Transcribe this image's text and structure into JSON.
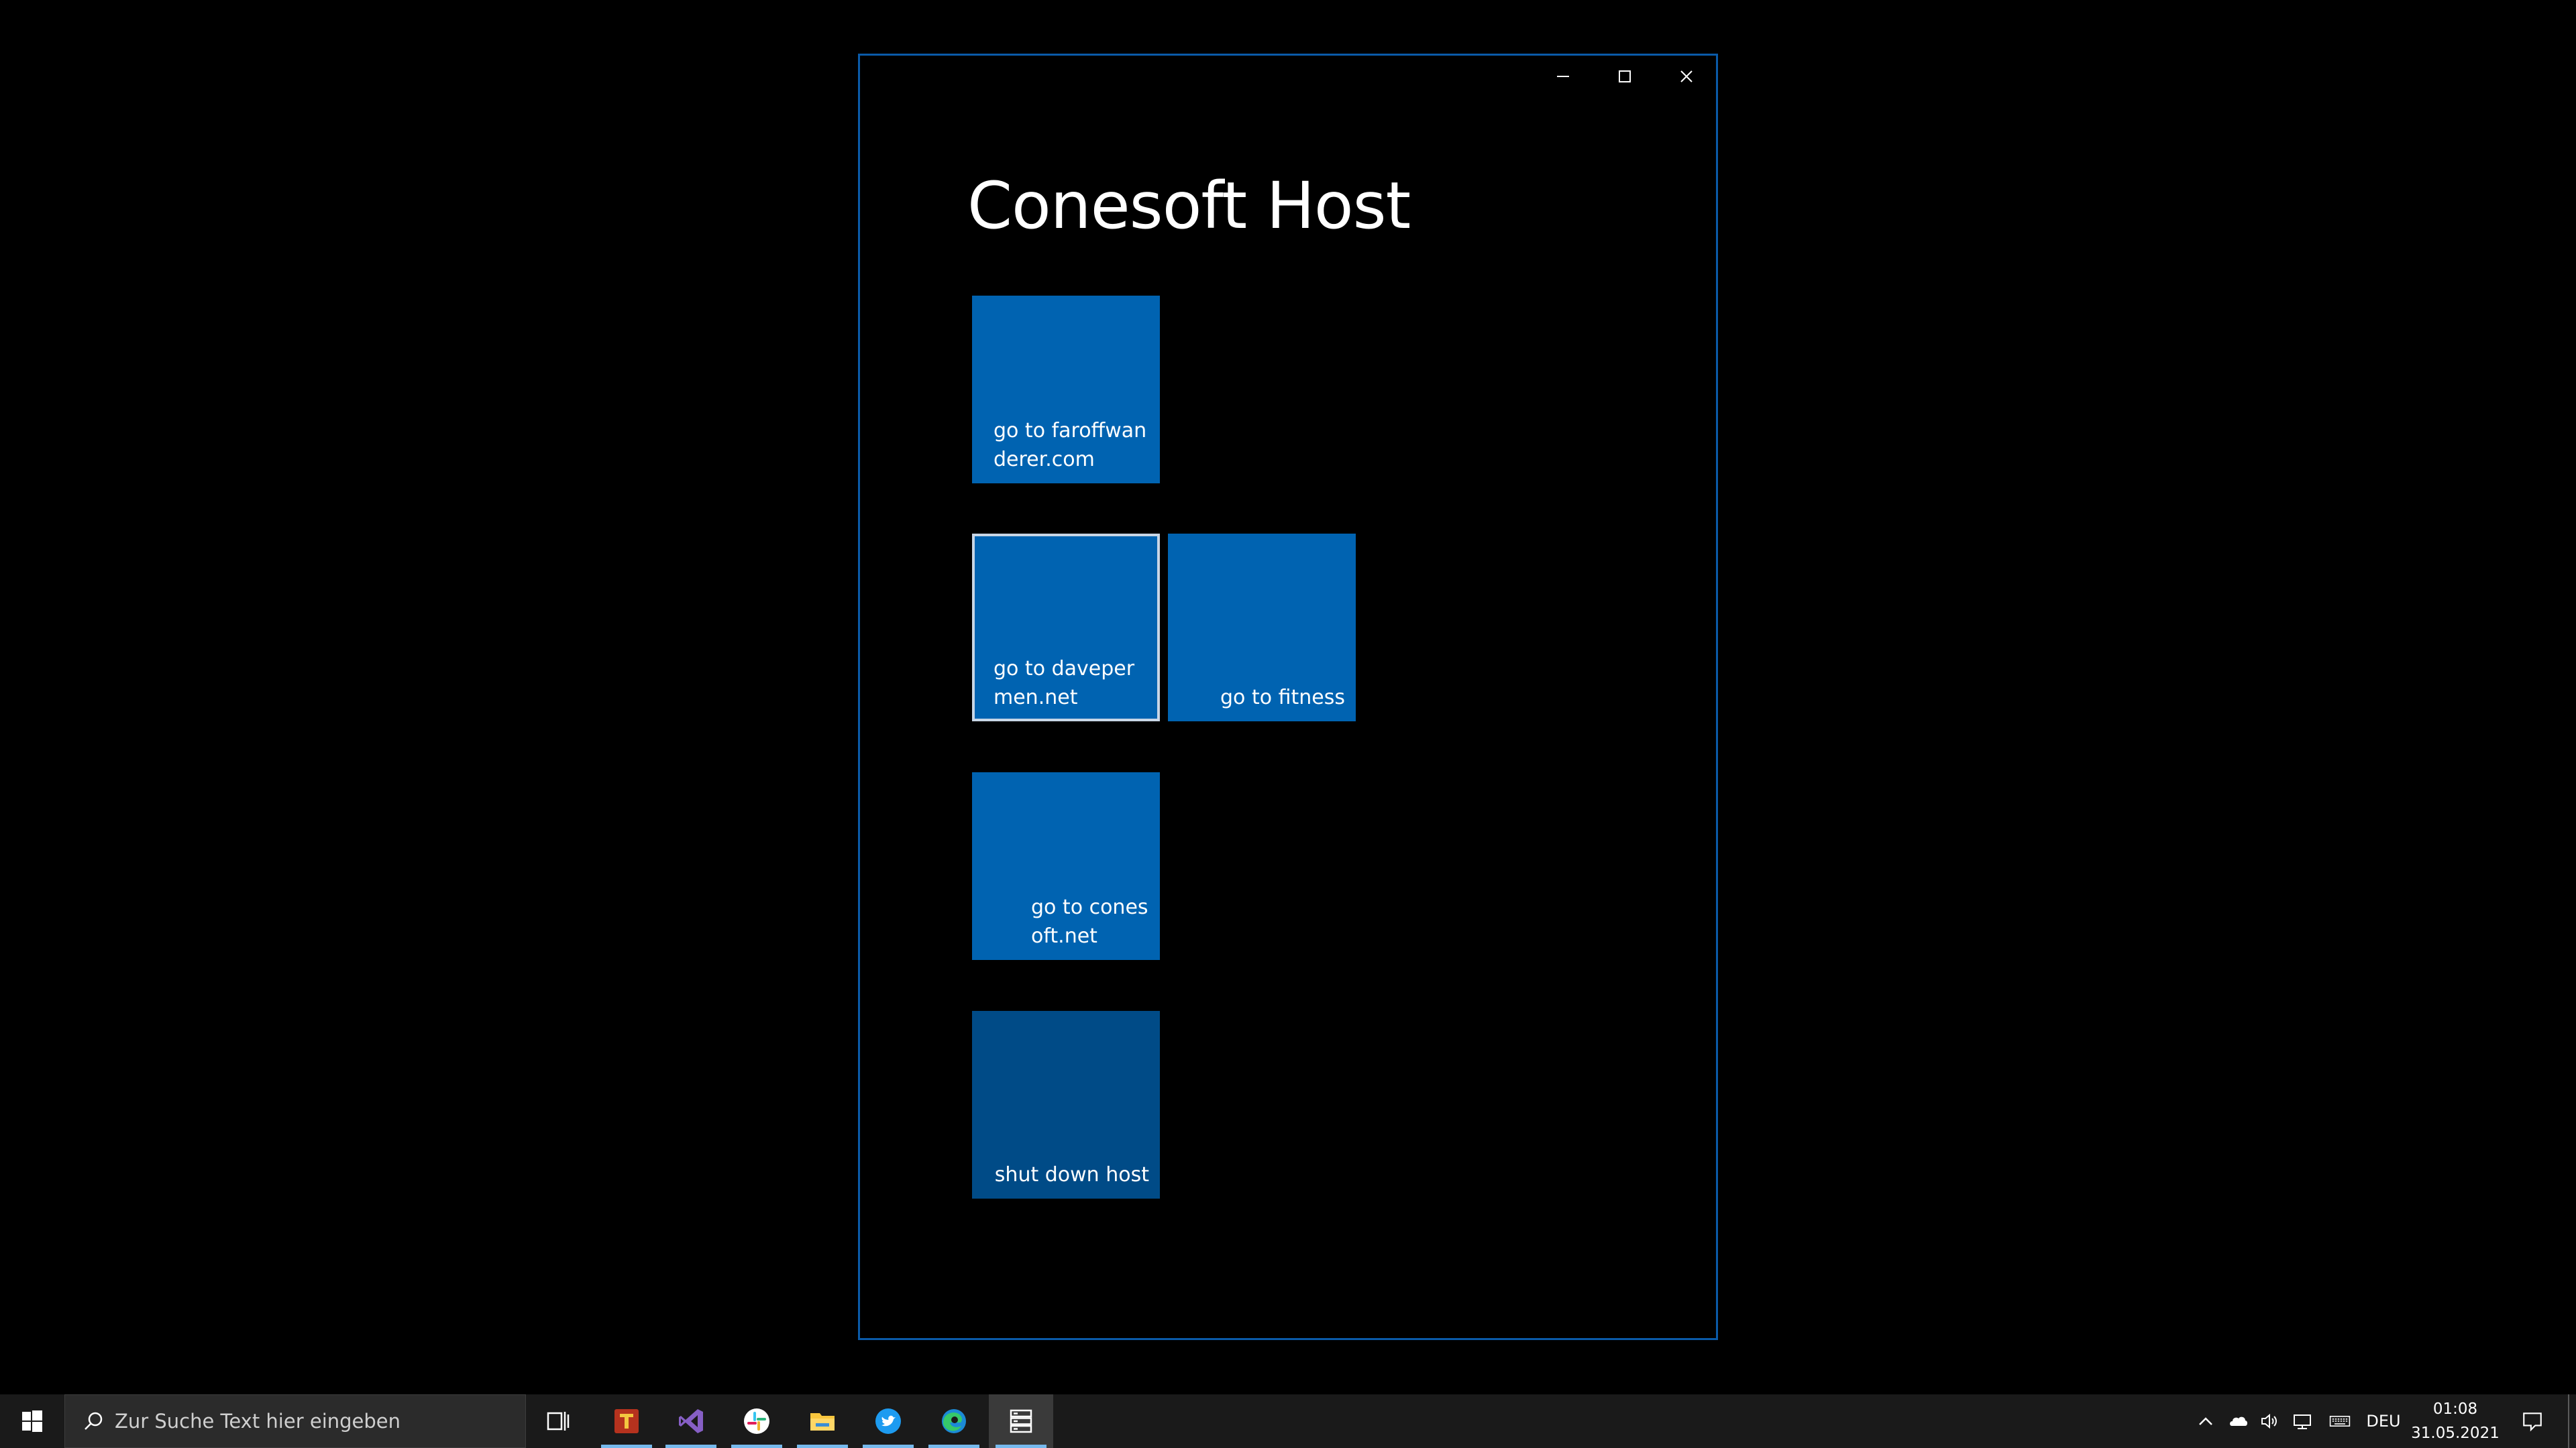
{
  "window": {
    "title": "Conesoft Host",
    "controls": {
      "minimize": "minimize",
      "maximize": "maximize",
      "close": "close"
    }
  },
  "tiles": [
    {
      "label": "go to faroffwanderer.com",
      "color": "#0063b1"
    },
    {
      "label": "go to davepermen.net",
      "color": "#0063b1",
      "focused": true
    },
    {
      "label": "go to fitness",
      "color": "#0063b1"
    },
    {
      "label": "go to conesoft.net",
      "color": "#0063b1"
    },
    {
      "label": "shut down host",
      "color": "#004b87"
    }
  ],
  "taskbar": {
    "search_placeholder": "Zur Suche Text hier eingeben",
    "apps": [
      {
        "icon": "task-view-icon"
      },
      {
        "icon": "typora-icon",
        "open": true
      },
      {
        "icon": "visual-studio-icon",
        "open": true
      },
      {
        "icon": "slack-icon",
        "open": true
      },
      {
        "icon": "file-explorer-icon",
        "open": true
      },
      {
        "icon": "twitter-icon",
        "open": true
      },
      {
        "icon": "edge-icon",
        "open": true
      },
      {
        "icon": "conesoft-host-icon",
        "open": true,
        "active": true
      }
    ],
    "tray": {
      "language": "DEU",
      "time": "01:08",
      "date": "31.05.2021"
    }
  },
  "colors": {
    "accent": "#0063b1",
    "accent_dark": "#004b87",
    "window_border": "#0a5aa8",
    "taskbar_bg": "#1a1a1a"
  }
}
